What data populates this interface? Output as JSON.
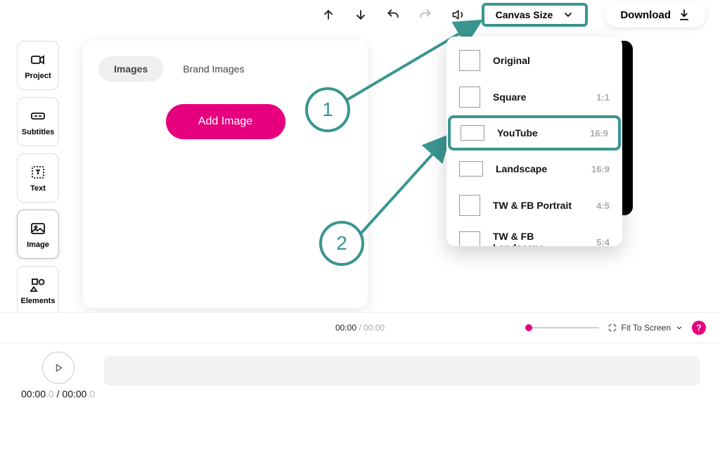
{
  "topbar": {
    "canvas_size_label": "Canvas Size",
    "download_label": "Download"
  },
  "rail": {
    "project": "Project",
    "subtitles": "Subtitles",
    "text": "Text",
    "image": "Image",
    "elements": "Elements"
  },
  "panel": {
    "tab_images": "Images",
    "tab_brand_images": "Brand Images",
    "add_image_label": "Add Image"
  },
  "dropdown": {
    "items": [
      {
        "label": "Original",
        "ratio": "",
        "shape": "square",
        "highlight": false
      },
      {
        "label": "Square",
        "ratio": "1:1",
        "shape": "square",
        "highlight": false
      },
      {
        "label": "YouTube",
        "ratio": "16:9",
        "shape": "wide",
        "highlight": true
      },
      {
        "label": "Landscape",
        "ratio": "16:9",
        "shape": "wide",
        "highlight": false
      },
      {
        "label": "TW & FB Portrait",
        "ratio": "4:5",
        "shape": "square",
        "highlight": false
      },
      {
        "label": "TW & FB Landscape",
        "ratio": "5:4",
        "shape": "square",
        "highlight": false
      }
    ]
  },
  "callouts": {
    "one": "1",
    "two": "2"
  },
  "status": {
    "current": "00:00",
    "total": "00:00",
    "fit_label": "Fit To Screen",
    "help": "?"
  },
  "timeline": {
    "current": "00:00",
    "current_fract": ".0",
    "sep": " / ",
    "total": "00:00",
    "total_fract": ".0"
  },
  "colors": {
    "accent_teal": "#3a9690",
    "accent_pink": "#e6007e"
  }
}
